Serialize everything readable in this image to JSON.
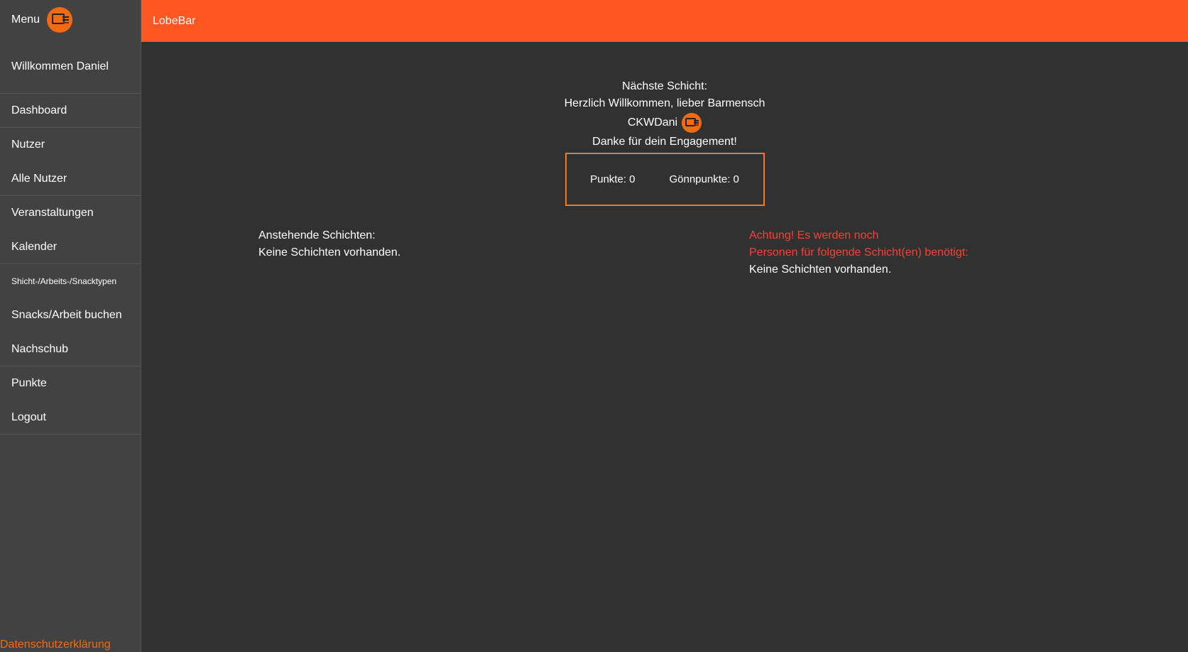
{
  "sidebar": {
    "menu_label": "Menu",
    "logo_icon": "smile-ecke-logo-icon",
    "welcome": "Willkommen Daniel",
    "items": [
      {
        "label": "Dashboard"
      },
      {
        "label": "Nutzer"
      },
      {
        "label": "Alle Nutzer"
      },
      {
        "label": "Veranstaltungen"
      },
      {
        "label": "Kalender"
      },
      {
        "label": "Shicht-/Arbeits-/Snacktypen"
      },
      {
        "label": "Snacks/Arbeit buchen"
      },
      {
        "label": "Nachschub"
      },
      {
        "label": "Punkte"
      },
      {
        "label": "Logout"
      }
    ],
    "privacy_link": "Datenschutzerklärung"
  },
  "topbar": {
    "title": "LobeBar"
  },
  "main": {
    "next_shift_label": "Nächste Schicht:",
    "greeting": "Herzlich Willkommen, lieber Barmensch",
    "username": "CKWDani",
    "thanks": "Danke für dein Engagement!",
    "points": "Punkte: 0",
    "goennpoints": "Gönnpunkte: 0",
    "upcoming_title": "Anstehende Schichten:",
    "upcoming_empty": "Keine Schichten vorhanden.",
    "needed_warning_1": "Achtung! Es werden noch",
    "needed_warning_2": "Personen für folgende Schicht(en) benötigt:",
    "needed_empty": "Keine Schichten vorhanden."
  },
  "colors": {
    "accent": "#ff5722",
    "logo": "#f26b12",
    "warning": "#f44336",
    "background": "#313131",
    "sidebar": "#424242"
  }
}
